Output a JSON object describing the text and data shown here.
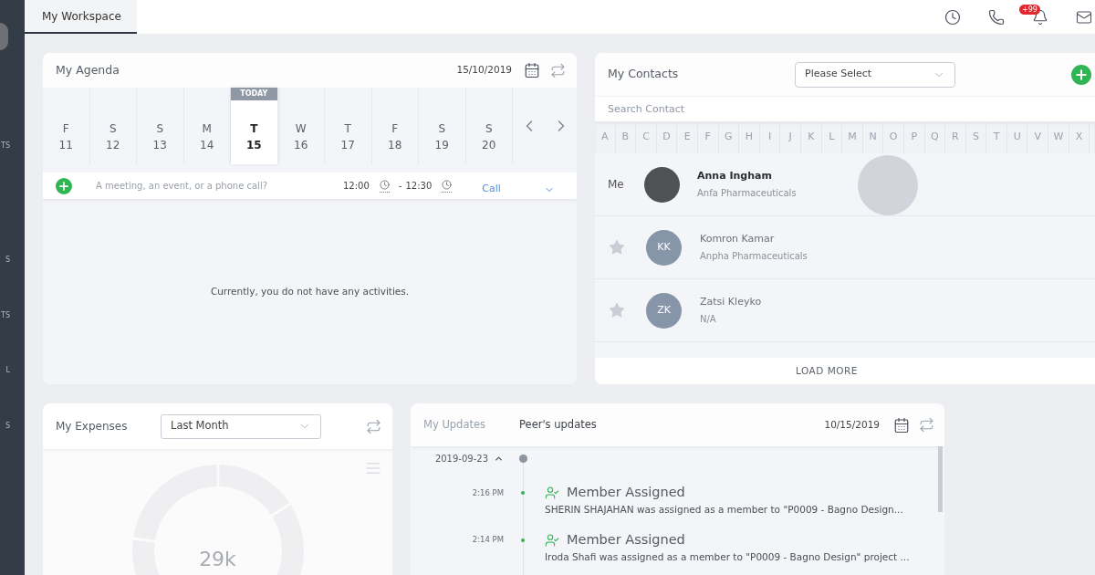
{
  "sidebar": {
    "items": [
      {
        "label": "TS"
      },
      {
        "label": "S"
      },
      {
        "label": "TS"
      },
      {
        "label": "L"
      },
      {
        "label": "S"
      }
    ]
  },
  "top_bar": {
    "tabs": [
      {
        "label": "My Workspace",
        "selected": true
      }
    ],
    "notifications_badge": "+99"
  },
  "agenda": {
    "title": "My Agenda",
    "date": "15/10/2019",
    "today_label": "TODAY",
    "days": [
      {
        "weekday": "F",
        "day": "11",
        "selected": false
      },
      {
        "weekday": "S",
        "day": "12",
        "selected": false
      },
      {
        "weekday": "S",
        "day": "13",
        "selected": false
      },
      {
        "weekday": "M",
        "day": "14",
        "selected": false
      },
      {
        "weekday": "T",
        "day": "15",
        "selected": true
      },
      {
        "weekday": "W",
        "day": "16",
        "selected": false
      },
      {
        "weekday": "T",
        "day": "17",
        "selected": false
      },
      {
        "weekday": "F",
        "day": "18",
        "selected": false
      },
      {
        "weekday": "S",
        "day": "19",
        "selected": false
      },
      {
        "weekday": "S",
        "day": "20",
        "selected": false
      }
    ],
    "new_activity": {
      "placeholder": "A meeting, an event, or a phone call?",
      "start_time": "12:00",
      "separator": "-",
      "end_time": "12:30",
      "type": "Call"
    },
    "empty_message": "Currently, you do not have any activities."
  },
  "contacts": {
    "title": "My Contacts",
    "filter": {
      "value": "Please Select"
    },
    "search": {
      "placeholder": "Search Contact"
    },
    "letters": [
      "A",
      "B",
      "C",
      "D",
      "E",
      "F",
      "G",
      "H",
      "I",
      "J",
      "K",
      "L",
      "M",
      "N",
      "O",
      "P",
      "Q",
      "R",
      "S",
      "T",
      "U",
      "V",
      "W",
      "X"
    ],
    "rows": [
      {
        "kind": "self",
        "label": "Me",
        "name": "Anna Ingham",
        "company": "Anfa Pharmaceuticals"
      },
      {
        "kind": "contact",
        "favorite": false,
        "initials": "KK",
        "name": "Komron Kamar",
        "company": "Anpha Pharmaceuticals"
      },
      {
        "kind": "contact",
        "favorite": false,
        "initials": "ZK",
        "name": "Zatsi Kleyko",
        "company": "N/A"
      }
    ],
    "load_more": "LOAD MORE"
  },
  "expenses": {
    "title": "My Expenses",
    "period": {
      "value": "Last Month"
    },
    "total": "29k"
  },
  "updates": {
    "tabs": [
      {
        "label": "My Updates",
        "selected": false
      },
      {
        "label": "Peer's updates",
        "selected": true
      }
    ],
    "date": "10/15/2019",
    "groups": [
      {
        "date": "2019-09-23",
        "expanded": true,
        "entries": [
          {
            "time": "2:16 PM",
            "title": "Member Assigned",
            "description": "SHERIN SHAJAHAN was assigned as a member to \"P0009 - Bagno Design..."
          },
          {
            "time": "2:14 PM",
            "title": "Member Assigned",
            "description": "Iroda Shafi was assigned as a member to \"P0009 - Bagno Design\" project ..."
          }
        ]
      }
    ]
  }
}
